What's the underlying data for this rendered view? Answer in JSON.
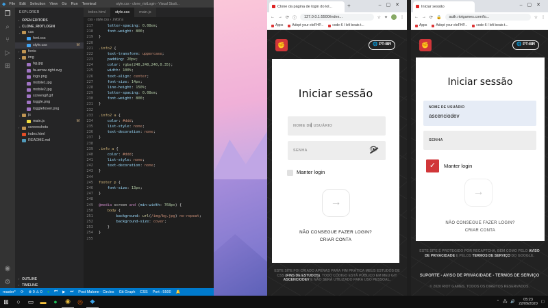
{
  "vscode": {
    "menu": [
      "File",
      "Edit",
      "Selection",
      "View",
      "Go",
      "Run",
      "Terminal"
    ],
    "window_title": "style.css - clone_riotLogin - Visual Studi...",
    "explorer": "EXPLORER",
    "open_editors": "OPEN EDITORS",
    "project": "CLONE_RIOTLOGIN",
    "tree": [
      {
        "label": "css",
        "kind": "folder",
        "indent": 1,
        "open": true
      },
      {
        "label": "font.css",
        "kind": "css",
        "indent": 2
      },
      {
        "label": "style.css",
        "kind": "css",
        "indent": 2,
        "mark": "M",
        "selected": true
      },
      {
        "label": "fonts",
        "kind": "folder",
        "indent": 1,
        "open": false
      },
      {
        "label": "img",
        "kind": "folder",
        "indent": 1,
        "open": true
      },
      {
        "label": "bg.jpg",
        "kind": "img",
        "indent": 2
      },
      {
        "label": "fa-arrow-right.svg",
        "kind": "img",
        "indent": 2
      },
      {
        "label": "logo.png",
        "kind": "img",
        "indent": 2
      },
      {
        "label": "mobile1.jpg",
        "kind": "img",
        "indent": 2
      },
      {
        "label": "mobile2.jpg",
        "kind": "img",
        "indent": 2
      },
      {
        "label": "screengif.gif",
        "kind": "img",
        "indent": 2
      },
      {
        "label": "toggle.png",
        "kind": "img",
        "indent": 2
      },
      {
        "label": "togglehover.png",
        "kind": "img",
        "indent": 2
      },
      {
        "label": "js",
        "kind": "folder",
        "indent": 1,
        "open": true
      },
      {
        "label": "main.js",
        "kind": "js",
        "indent": 2,
        "mark": "M"
      },
      {
        "label": "screenshots",
        "kind": "folder",
        "indent": 1,
        "open": false
      },
      {
        "label": "index.html",
        "kind": "html",
        "indent": 1
      },
      {
        "label": "README.md",
        "kind": "md",
        "indent": 1
      }
    ],
    "outline": "OUTLINE",
    "timeline": "TIMELINE",
    "tabs": [
      "index.html",
      "style.css",
      "main.js"
    ],
    "active_tab": 1,
    "breadcrumb": "css › style.css › .info2 a",
    "code": [
      {
        "n": "217",
        "t": [
          [
            "    ",
            "pun"
          ],
          [
            "letter-spacing",
            "prop"
          ],
          [
            ": ",
            "pun"
          ],
          [
            "0.08em",
            "num"
          ],
          [
            ";",
            "pun"
          ]
        ]
      },
      {
        "n": "218",
        "t": [
          [
            "    ",
            "pun"
          ],
          [
            "font-weight",
            "prop"
          ],
          [
            ": ",
            "pun"
          ],
          [
            "800",
            "num"
          ],
          [
            ";",
            "pun"
          ]
        ]
      },
      {
        "n": "219",
        "t": [
          [
            "}",
            "pun"
          ]
        ]
      },
      {
        "n": "220",
        "t": []
      },
      {
        "n": "221",
        "t": [
          [
            ".info2",
            "sel-c"
          ],
          [
            " {",
            "pun"
          ]
        ]
      },
      {
        "n": "222",
        "t": [
          [
            "    ",
            "pun"
          ],
          [
            "text-transform",
            "prop"
          ],
          [
            ": ",
            "pun"
          ],
          [
            "uppercase",
            "val"
          ],
          [
            ";",
            "pun"
          ]
        ]
      },
      {
        "n": "223",
        "t": [
          [
            "    ",
            "pun"
          ],
          [
            "padding",
            "prop"
          ],
          [
            ": ",
            "pun"
          ],
          [
            "20px",
            "num"
          ],
          [
            ";",
            "pun"
          ]
        ]
      },
      {
        "n": "224",
        "t": [
          [
            "    ",
            "pun"
          ],
          [
            "color",
            "prop"
          ],
          [
            ": ",
            "pun"
          ],
          [
            "rgba(240,240,240,0.35)",
            "num"
          ],
          [
            ";",
            "pun"
          ]
        ]
      },
      {
        "n": "225",
        "t": [
          [
            "    ",
            "pun"
          ],
          [
            "width",
            "prop"
          ],
          [
            ": ",
            "pun"
          ],
          [
            "100%",
            "num"
          ],
          [
            ";",
            "pun"
          ]
        ]
      },
      {
        "n": "226",
        "t": [
          [
            "    ",
            "pun"
          ],
          [
            "text-align",
            "prop"
          ],
          [
            ": ",
            "pun"
          ],
          [
            "center",
            "val"
          ],
          [
            ";",
            "pun"
          ]
        ]
      },
      {
        "n": "227",
        "t": [
          [
            "    ",
            "pun"
          ],
          [
            "font-size",
            "prop"
          ],
          [
            ": ",
            "pun"
          ],
          [
            "14px",
            "num"
          ],
          [
            ";",
            "pun"
          ]
        ]
      },
      {
        "n": "228",
        "t": [
          [
            "    ",
            "pun"
          ],
          [
            "line-height",
            "prop"
          ],
          [
            ": ",
            "pun"
          ],
          [
            "150%",
            "num"
          ],
          [
            ";",
            "pun"
          ]
        ]
      },
      {
        "n": "229",
        "t": [
          [
            "    ",
            "pun"
          ],
          [
            "letter-spacing",
            "prop"
          ],
          [
            ": ",
            "pun"
          ],
          [
            "0.08em",
            "num"
          ],
          [
            ";",
            "pun"
          ]
        ]
      },
      {
        "n": "230",
        "t": [
          [
            "    ",
            "pun"
          ],
          [
            "font-weight",
            "prop"
          ],
          [
            ": ",
            "pun"
          ],
          [
            "800",
            "num"
          ],
          [
            ";",
            "pun"
          ]
        ]
      },
      {
        "n": "231",
        "t": [
          [
            "}",
            "pun"
          ]
        ]
      },
      {
        "n": "232",
        "t": []
      },
      {
        "n": "233",
        "t": [
          [
            ".info2 a",
            "sel-c"
          ],
          [
            " {",
            "pun"
          ]
        ]
      },
      {
        "n": "234",
        "t": [
          [
            "    ",
            "pun"
          ],
          [
            "color",
            "prop"
          ],
          [
            ": ",
            "pun"
          ],
          [
            "#ddd",
            "val"
          ],
          [
            ";",
            "pun"
          ]
        ]
      },
      {
        "n": "235",
        "t": [
          [
            "    ",
            "pun"
          ],
          [
            "list-style",
            "prop"
          ],
          [
            ": ",
            "pun"
          ],
          [
            "none",
            "val"
          ],
          [
            ";",
            "pun"
          ]
        ]
      },
      {
        "n": "236",
        "t": [
          [
            "    ",
            "pun"
          ],
          [
            "text-decoration",
            "prop"
          ],
          [
            ": ",
            "pun"
          ],
          [
            "none",
            "val"
          ],
          [
            ";",
            "pun"
          ]
        ]
      },
      {
        "n": "237",
        "t": [
          [
            "}",
            "pun"
          ]
        ]
      },
      {
        "n": "238",
        "t": []
      },
      {
        "n": "239",
        "t": [
          [
            ".info a",
            "sel-c"
          ],
          [
            " {",
            "pun"
          ]
        ]
      },
      {
        "n": "240",
        "t": [
          [
            "    ",
            "pun"
          ],
          [
            "color",
            "prop"
          ],
          [
            ": ",
            "pun"
          ],
          [
            "#ddd",
            "val"
          ],
          [
            ";",
            "pun"
          ]
        ]
      },
      {
        "n": "241",
        "t": [
          [
            "    ",
            "pun"
          ],
          [
            "list-style",
            "prop"
          ],
          [
            ": ",
            "pun"
          ],
          [
            "none",
            "val"
          ],
          [
            ";",
            "pun"
          ]
        ]
      },
      {
        "n": "242",
        "t": [
          [
            "    ",
            "pun"
          ],
          [
            "text-decoration",
            "prop"
          ],
          [
            ": ",
            "pun"
          ],
          [
            "none",
            "val"
          ],
          [
            ";",
            "pun"
          ]
        ]
      },
      {
        "n": "243",
        "t": [
          [
            "}",
            "pun"
          ]
        ]
      },
      {
        "n": "244",
        "t": []
      },
      {
        "n": "245",
        "t": [
          [
            "footer p",
            "sel-c"
          ],
          [
            " {",
            "pun"
          ]
        ]
      },
      {
        "n": "246",
        "t": [
          [
            "    ",
            "pun"
          ],
          [
            "font-size",
            "prop"
          ],
          [
            ": ",
            "pun"
          ],
          [
            "13px",
            "num"
          ],
          [
            ";",
            "pun"
          ]
        ]
      },
      {
        "n": "247",
        "t": [
          [
            "}",
            "pun"
          ]
        ]
      },
      {
        "n": "248",
        "t": []
      },
      {
        "n": "249",
        "t": [
          [
            "@media",
            "kw"
          ],
          [
            " screen ",
            "pun"
          ],
          [
            "and",
            "kw"
          ],
          [
            " (",
            "pun"
          ],
          [
            "min-width",
            "prop"
          ],
          [
            ": ",
            "pun"
          ],
          [
            "768px",
            "num"
          ],
          [
            ") {",
            "pun"
          ]
        ]
      },
      {
        "n": "250",
        "t": [
          [
            "    ",
            "pun"
          ],
          [
            "body",
            "sel-c"
          ],
          [
            " {",
            "pun"
          ]
        ]
      },
      {
        "n": "251",
        "t": [
          [
            "        ",
            "pun"
          ],
          [
            "background",
            "prop"
          ],
          [
            ": ",
            "pun"
          ],
          [
            "url",
            "fn"
          ],
          [
            "(",
            "pun"
          ],
          [
            "/img/bg.jpg",
            "val"
          ],
          [
            ") ",
            "pun"
          ],
          [
            "no-repeat",
            "val"
          ],
          [
            ";",
            "pun"
          ]
        ]
      },
      {
        "n": "252",
        "t": [
          [
            "        ",
            "pun"
          ],
          [
            "background-size",
            "prop"
          ],
          [
            ": ",
            "pun"
          ],
          [
            "cover",
            "val"
          ],
          [
            ";",
            "pun"
          ]
        ]
      },
      {
        "n": "253",
        "t": [
          [
            "    ",
            "pun"
          ],
          [
            "}",
            "pun"
          ]
        ]
      },
      {
        "n": "254",
        "t": [
          [
            "}",
            "pun"
          ]
        ]
      },
      {
        "n": "255",
        "t": []
      }
    ],
    "status": {
      "branch": "master*",
      "music": "Post Malone - Circles",
      "graph": "Git Graph",
      "lang": "CSS",
      "port": "Port : 5500"
    }
  },
  "browser1": {
    "tab_title": "Clone da página de login do lol...",
    "url": "127.0.0.1:5500/index...",
    "bookmarks": [
      "Apps",
      "Adopt your eleFHP...",
      "code-6 / lofi beats t..."
    ],
    "lang": "PT-BR",
    "title": "Iniciar sessão",
    "user_placeholder": "NOME DE USUÁRIO",
    "pass_placeholder": "SENHA",
    "remember": "Manter login",
    "forgot": "NÃO CONSEGUE FAZER LOGIN?",
    "create": "CRIAR CONTA",
    "footer_a": "ESTE SITE FOI CRIADO APENAS PARA FIM PRÁTICA MEUS ESTUDOS DE CSS",
    "footer_b": "(FINS DE ESTUDOS)",
    "footer_c": ". TODO CÓDIGO ESTÁ PÚBLICO EM MEU GIT",
    "footer_d": "ASCENCIODEV",
    "footer_e": "E NÃO SERÁ UTILIZADO PARA USO PESSOAL."
  },
  "browser2": {
    "tab_title": "Iniciar sessão",
    "url": "auth.riotgames.com/lo...",
    "bookmarks": [
      "Apps",
      "Adopt your eleFHP...",
      "code-6 / lofi beats t..."
    ],
    "lang": "PT-BR",
    "title": "Iniciar sessão",
    "user_label": "NOME DE USUÁRIO",
    "user_value": "ascenciodev",
    "pass_label": "SENHA",
    "remember": "Manter login",
    "forgot": "NÃO CONSEGUE FAZER LOGIN?",
    "create": "CRIAR CONTA",
    "footer_a": "ESTE SITE É PROTEGIDO POR RECAPTCHA, BEM COMO PELO",
    "footer_b": "AVISO DE PRIVACIDADE",
    "footer_c": "E PELOS",
    "footer_d": "TERMOS DE SERVIÇO",
    "footer_e": "DO GOOGLE.",
    "links": "SUPORTE - AVISO DE PRIVACIDADE - TERMOS DE SERVIÇO",
    "copyright": "© 2020 RIOT GAMES. TODOS OS DIREITOS RESERVADOS."
  },
  "taskbar": {
    "time": "05:23",
    "date": "22/09/2020"
  },
  "colors": {
    "riot_red": "#d13639",
    "vscode_blue": "#007acc"
  }
}
